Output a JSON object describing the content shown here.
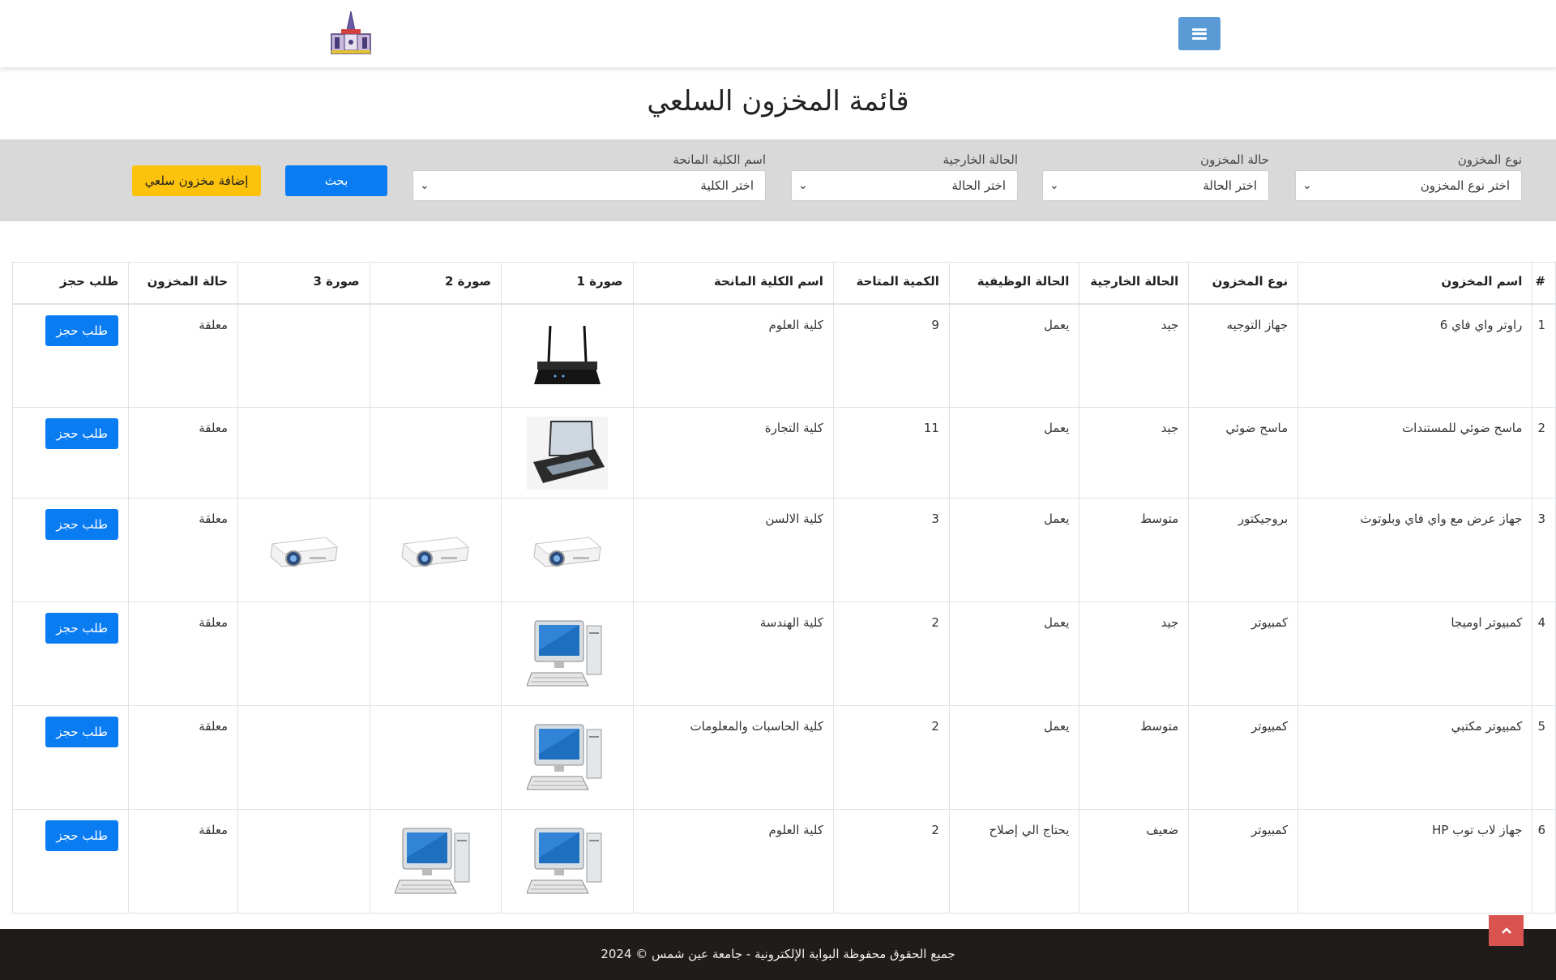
{
  "page": {
    "title": "قائمة المخزون السلعي"
  },
  "header": {
    "logo_icon": "university-logo-icon",
    "menu_icon": "hamburger-menu-icon"
  },
  "filters": {
    "type": {
      "label": "نوع المخزون",
      "value": "اختر نوع المخزون"
    },
    "status": {
      "label": "حالة المخزون",
      "value": "اختر الحالة"
    },
    "external": {
      "label": "الحالة الخارجية",
      "value": "اختر الحالة"
    },
    "faculty": {
      "label": "اسم الكلية المانحة",
      "value": "اختر الكلية"
    },
    "search_label": "بحث",
    "add_label": "إضافة مخزون سلعي"
  },
  "table": {
    "headers": [
      "#",
      "اسم المخزون",
      "نوع المخزون",
      "الحالة الخارجية",
      "الحالة الوظيفية",
      "الكمية المتاحة",
      "اسم الكلية المانحة",
      "صورة 1",
      "صورة 2",
      "صورة 3",
      "حالة المخزون",
      "طلب حجز"
    ],
    "rows": [
      {
        "num": "1",
        "name": "راوتر واي فاي 6",
        "type": "جهاز التوجيه",
        "external": "جيد",
        "functional": "يعمل",
        "qty": "9",
        "faculty": "كلية العلوم",
        "img1": "router",
        "img2": "",
        "img3": "",
        "status": "معلقة",
        "action": "طلب حجز"
      },
      {
        "num": "2",
        "name": "ماسح ضوئي للمستندات",
        "type": "ماسح ضوئي",
        "external": "جيد",
        "functional": "يعمل",
        "qty": "11",
        "faculty": "كلية التجارة",
        "img1": "scanner",
        "img2": "",
        "img3": "",
        "status": "معلقة",
        "action": "طلب حجز"
      },
      {
        "num": "3",
        "name": "جهاز عرض مع واي فاي وبلوتوث",
        "type": "بروجيكتور",
        "external": "متوسط",
        "functional": "يعمل",
        "qty": "3",
        "faculty": "كلية الالسن",
        "img1": "projector",
        "img2": "projector",
        "img3": "projector",
        "status": "معلقة",
        "action": "طلب حجز"
      },
      {
        "num": "4",
        "name": "كمبيوتر اوميجا",
        "type": "كمبيوتر",
        "external": "جيد",
        "functional": "يعمل",
        "qty": "2",
        "faculty": "كلية الهندسة",
        "img1": "computer",
        "img2": "",
        "img3": "",
        "status": "معلقة",
        "action": "طلب حجز"
      },
      {
        "num": "5",
        "name": "كمبيوتر مكتبي",
        "type": "كمبيوتر",
        "external": "متوسط",
        "functional": "يعمل",
        "qty": "2",
        "faculty": "كلية الحاسبات والمعلومات",
        "img1": "computer",
        "img2": "",
        "img3": "",
        "status": "معلقة",
        "action": "طلب حجز"
      },
      {
        "num": "6",
        "name": "جهاز لاب توب HP",
        "type": "كمبيوتر",
        "external": "ضعيف",
        "functional": "يحتاج الي إصلاح",
        "qty": "2",
        "faculty": "كلية العلوم",
        "img1": "computer",
        "img2": "computer",
        "img3": "",
        "status": "معلقة",
        "action": "طلب حجز"
      }
    ]
  },
  "footer": {
    "text": "جميع الحقوق محفوظة البوابة الإلكترونية - جامعة عين شمس © 2024"
  },
  "colors": {
    "primary": "#0a7cf2",
    "warning": "#fdc20b",
    "filter_bg": "#d9d9d9",
    "footer_bg": "#1f1c1a",
    "menu_btn": "#5b9bd5",
    "scroll_top": "#d9534f"
  }
}
